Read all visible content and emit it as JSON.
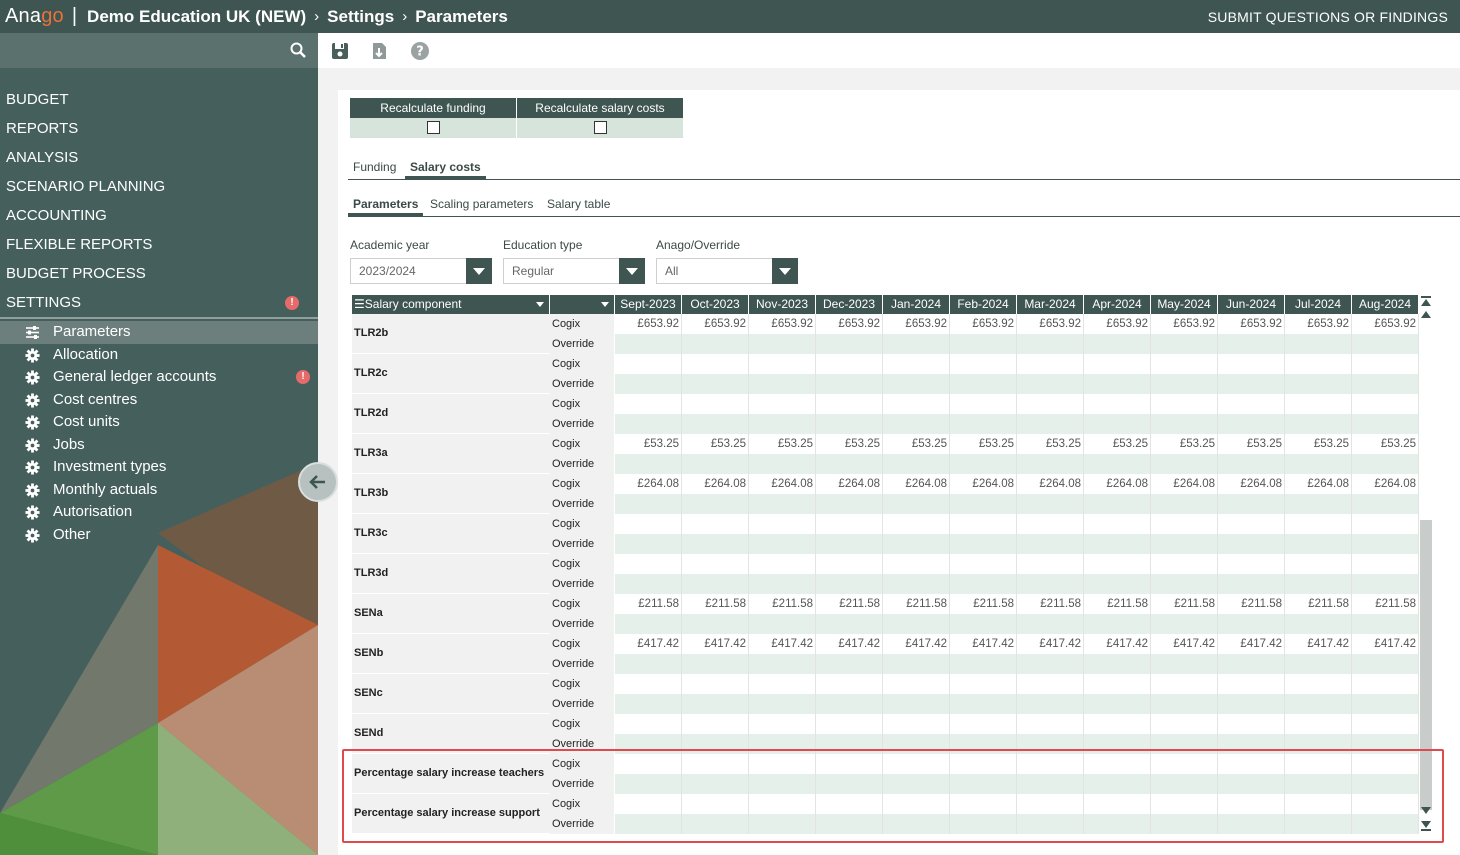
{
  "topbar": {
    "logo_main": "Ana",
    "logo_accent": "go",
    "separator": "|",
    "breadcrumb": [
      "Demo Education UK (NEW)",
      "Settings",
      "Parameters"
    ],
    "submit_label": "SUBMIT QUESTIONS OR FINDINGS"
  },
  "sidebar": {
    "search_icon": "search-icon",
    "nav": [
      {
        "label": "BUDGET"
      },
      {
        "label": "REPORTS"
      },
      {
        "label": "ANALYSIS"
      },
      {
        "label": "SCENARIO PLANNING"
      },
      {
        "label": "ACCOUNTING"
      },
      {
        "label": "FLEXIBLE REPORTS"
      },
      {
        "label": "BUDGET PROCESS"
      },
      {
        "label": "SETTINGS",
        "alert": "!"
      }
    ],
    "subnav": [
      {
        "label": "Parameters",
        "icon": "sliders-icon",
        "active": true
      },
      {
        "label": "Allocation",
        "icon": "gear-icon"
      },
      {
        "label": "General ledger accounts",
        "icon": "gear-icon",
        "alert": "!"
      },
      {
        "label": "Cost centres",
        "icon": "gear-icon"
      },
      {
        "label": "Cost units",
        "icon": "gear-icon"
      },
      {
        "label": "Jobs",
        "icon": "gear-icon"
      },
      {
        "label": "Investment types",
        "icon": "gear-icon"
      },
      {
        "label": "Monthly actuals",
        "icon": "gear-icon"
      },
      {
        "label": "Autorisation",
        "icon": "gear-icon"
      },
      {
        "label": "Other",
        "icon": "gear-icon"
      }
    ]
  },
  "toolbar": {
    "icons": [
      "save-icon",
      "download-icon",
      "help-icon"
    ]
  },
  "recalc": {
    "funding_label": "Recalculate funding",
    "salary_label": "Recalculate salary costs"
  },
  "tabs_main": {
    "items": [
      "Funding",
      "Salary costs"
    ],
    "active": 1
  },
  "tabs_sub": {
    "items": [
      "Parameters",
      "Scaling parameters",
      "Salary table"
    ],
    "active": 0
  },
  "filters": {
    "academic_year": {
      "label": "Academic year",
      "value": "2023/2024"
    },
    "education_type": {
      "label": "Education type",
      "value": "Regular"
    },
    "anago_override": {
      "label": "Anago/Override",
      "value": "All"
    }
  },
  "grid": {
    "component_header": "Salary component",
    "months": [
      "Sept-2023",
      "Oct-2023",
      "Nov-2023",
      "Dec-2023",
      "Jan-2024",
      "Feb-2024",
      "Mar-2024",
      "Apr-2024",
      "May-2024",
      "Jun-2024",
      "Jul-2024",
      "Aug-2024"
    ],
    "source_labels": [
      "Cogix",
      "Override"
    ],
    "rows": [
      {
        "name": "TLR2b",
        "cogix": "£653.92"
      },
      {
        "name": "TLR2c",
        "cogix": ""
      },
      {
        "name": "TLR2d",
        "cogix": ""
      },
      {
        "name": "TLR3a",
        "cogix": "£53.25"
      },
      {
        "name": "TLR3b",
        "cogix": "£264.08"
      },
      {
        "name": "TLR3c",
        "cogix": ""
      },
      {
        "name": "TLR3d",
        "cogix": ""
      },
      {
        "name": "SENa",
        "cogix": "£211.58"
      },
      {
        "name": "SENb",
        "cogix": "£417.42"
      },
      {
        "name": "SENc",
        "cogix": ""
      },
      {
        "name": "SENd",
        "cogix": ""
      },
      {
        "name": "Percentage salary increase teachers",
        "cogix": ""
      },
      {
        "name": "Percentage salary increase support",
        "cogix": ""
      }
    ]
  },
  "colors": {
    "header": "#3e5551",
    "sidebar": "#45605c",
    "accent": "#e8713a",
    "alert": "#e56b6b",
    "highlight": "#e04a4a"
  }
}
